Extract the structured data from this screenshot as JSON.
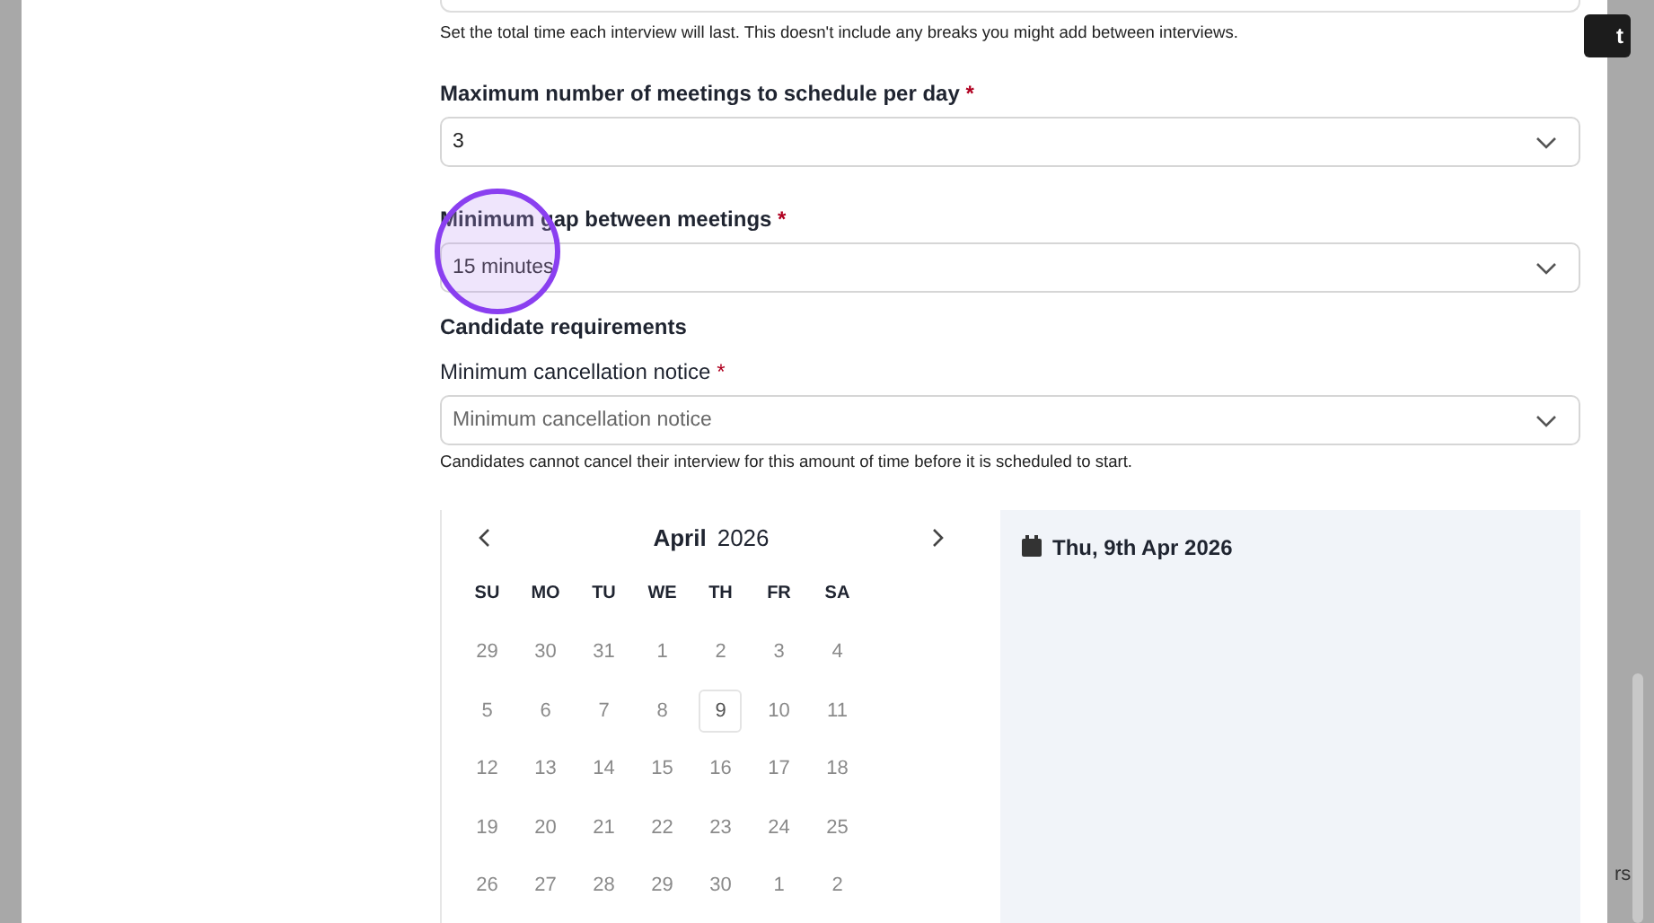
{
  "duration_help": "Set the total time each interview will last. This doesn't include any breaks you might add between interviews.",
  "fields": [
    {
      "label": "Maximum number of meetings to schedule per day",
      "required_mark": "*",
      "bold": true,
      "value": "3"
    },
    {
      "label": "Minimum gap between meetings",
      "required_mark": "*",
      "bold": true,
      "value": "15 minutes",
      "highlighted": true
    }
  ],
  "candidate_section": {
    "heading": "Candidate requirements",
    "field": {
      "label": "Minimum cancellation notice",
      "required_mark": "*",
      "bold": false,
      "placeholder": "Minimum cancellation notice"
    },
    "help": "Candidates cannot cancel their interview for this amount of time before it is scheduled to start."
  },
  "calendar": {
    "month": "April",
    "year": "2026",
    "weekdays": [
      "SU",
      "MO",
      "TU",
      "WE",
      "TH",
      "FR",
      "SA"
    ],
    "weeks": [
      [
        {
          "label": "29",
          "selected": false
        },
        {
          "label": "30",
          "selected": false
        },
        {
          "label": "31",
          "selected": false
        },
        {
          "label": "1",
          "selected": false
        },
        {
          "label": "2",
          "selected": false
        },
        {
          "label": "3",
          "selected": false
        },
        {
          "label": "4",
          "selected": false
        }
      ],
      [
        {
          "label": "5",
          "selected": false
        },
        {
          "label": "6",
          "selected": false
        },
        {
          "label": "7",
          "selected": false
        },
        {
          "label": "8",
          "selected": false
        },
        {
          "label": "9",
          "selected": true
        },
        {
          "label": "10",
          "selected": false
        },
        {
          "label": "11",
          "selected": false
        }
      ],
      [
        {
          "label": "12",
          "selected": false
        },
        {
          "label": "13",
          "selected": false
        },
        {
          "label": "14",
          "selected": false
        },
        {
          "label": "15",
          "selected": false
        },
        {
          "label": "16",
          "selected": false
        },
        {
          "label": "17",
          "selected": false
        },
        {
          "label": "18",
          "selected": false
        }
      ],
      [
        {
          "label": "19",
          "selected": false
        },
        {
          "label": "20",
          "selected": false
        },
        {
          "label": "21",
          "selected": false
        },
        {
          "label": "22",
          "selected": false
        },
        {
          "label": "23",
          "selected": false
        },
        {
          "label": "24",
          "selected": false
        },
        {
          "label": "25",
          "selected": false
        }
      ],
      [
        {
          "label": "26",
          "selected": false
        },
        {
          "label": "27",
          "selected": false
        },
        {
          "label": "28",
          "selected": false
        },
        {
          "label": "29",
          "selected": false
        },
        {
          "label": "30",
          "selected": false
        },
        {
          "label": "1",
          "selected": false
        },
        {
          "label": "2",
          "selected": false
        }
      ]
    ]
  },
  "selected_date": "Thu, 9th Apr 2026",
  "background": {
    "button_text": "t",
    "text": "rs"
  }
}
